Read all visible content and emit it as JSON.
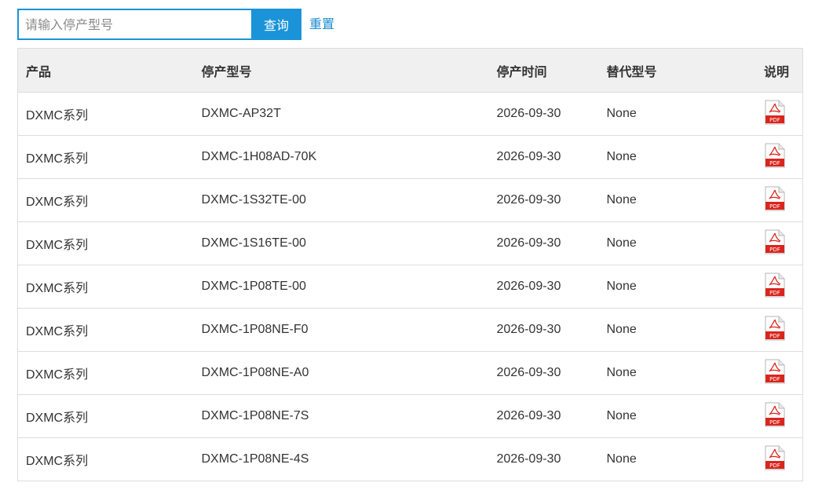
{
  "search": {
    "placeholder": "请输入停产型号",
    "value": "",
    "button_label": "查询",
    "reset_label": "重置"
  },
  "table": {
    "headers": {
      "product": "产品",
      "model": "停产型号",
      "date": "停产时间",
      "replacement": "替代型号",
      "doc": "说明"
    },
    "rows": [
      {
        "product": "DXMC系列",
        "model": "DXMC-AP32T",
        "date": "2026-09-30",
        "replacement": "None",
        "doc_icon": "pdf-icon"
      },
      {
        "product": "DXMC系列",
        "model": "DXMC-1H08AD-70K",
        "date": "2026-09-30",
        "replacement": "None",
        "doc_icon": "pdf-icon"
      },
      {
        "product": "DXMC系列",
        "model": "DXMC-1S32TE-00",
        "date": "2026-09-30",
        "replacement": "None",
        "doc_icon": "pdf-icon"
      },
      {
        "product": "DXMC系列",
        "model": "DXMC-1S16TE-00",
        "date": "2026-09-30",
        "replacement": "None",
        "doc_icon": "pdf-icon"
      },
      {
        "product": "DXMC系列",
        "model": "DXMC-1P08TE-00",
        "date": "2026-09-30",
        "replacement": "None",
        "doc_icon": "pdf-icon"
      },
      {
        "product": "DXMC系列",
        "model": "DXMC-1P08NE-F0",
        "date": "2026-09-30",
        "replacement": "None",
        "doc_icon": "pdf-icon"
      },
      {
        "product": "DXMC系列",
        "model": "DXMC-1P08NE-A0",
        "date": "2026-09-30",
        "replacement": "None",
        "doc_icon": "pdf-icon"
      },
      {
        "product": "DXMC系列",
        "model": "DXMC-1P08NE-7S",
        "date": "2026-09-30",
        "replacement": "None",
        "doc_icon": "pdf-icon"
      },
      {
        "product": "DXMC系列",
        "model": "DXMC-1P08NE-4S",
        "date": "2026-09-30",
        "replacement": "None",
        "doc_icon": "pdf-icon"
      }
    ]
  },
  "colors": {
    "accent": "#1b93d8",
    "link": "#1b8bd0",
    "header_bg": "#f0f0f0",
    "border": "#dddddd",
    "pdf_red": "#d9251c"
  }
}
